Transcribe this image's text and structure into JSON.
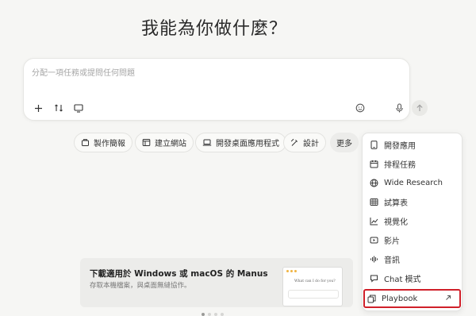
{
  "heading": "我能為你做什麼？",
  "composer": {
    "placeholder": "分配一項任務或提問任何問題",
    "tools": [
      "plus-icon",
      "connector-icon",
      "monitor-icon",
      "smiley-icon",
      "mic-icon",
      "arrow-up-icon"
    ]
  },
  "chips": [
    {
      "label": "製作簡報",
      "icon": "slides-icon"
    },
    {
      "label": "建立網站",
      "icon": "website-icon"
    },
    {
      "label": "開發桌面應用程式",
      "icon": "laptop-icon"
    },
    {
      "label": "設計",
      "icon": "design-icon"
    },
    {
      "label": "更多",
      "icon": ""
    }
  ],
  "banner": {
    "title": "下載適用於 Windows 或 macOS 的 Manus",
    "subtitle": "存取本機檔案，與桌面無縫協作。",
    "mock_text": "What can I do for you?"
  },
  "menu": {
    "items": [
      {
        "label": "開發應用",
        "icon": "mobile-icon"
      },
      {
        "label": "排程任務",
        "icon": "calendar-icon"
      },
      {
        "label": "Wide Research",
        "icon": "globe-icon"
      },
      {
        "label": "試算表",
        "icon": "table-icon"
      },
      {
        "label": "視覺化",
        "icon": "chart-icon"
      },
      {
        "label": "影片",
        "icon": "video-icon"
      },
      {
        "label": "音訊",
        "icon": "audio-wave-icon"
      },
      {
        "label": "Chat 模式",
        "icon": "chat-icon"
      },
      {
        "label": "Playbook",
        "icon": "playbook-icon"
      }
    ]
  },
  "colors": {
    "background": "#f6f6f4",
    "highlight_border": "#d0202a"
  }
}
